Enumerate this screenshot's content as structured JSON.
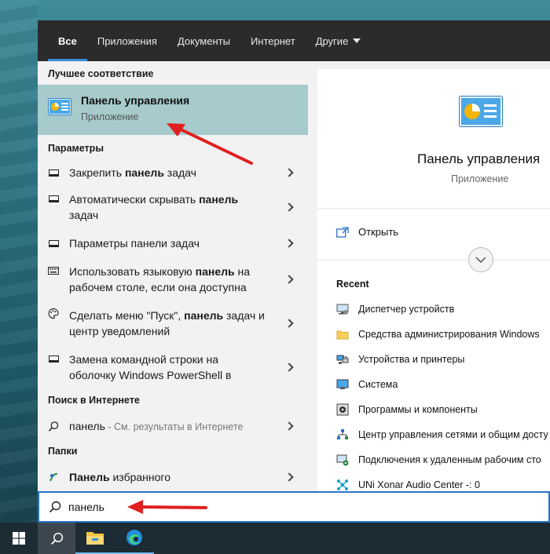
{
  "tabs": [
    {
      "label": "Все",
      "active": true
    },
    {
      "label": "Приложения"
    },
    {
      "label": "Документы"
    },
    {
      "label": "Интернет"
    },
    {
      "label": "Другие"
    }
  ],
  "best_match": {
    "heading": "Лучшее соответствие",
    "title": "Панель управления",
    "subtitle": "Приложение"
  },
  "settings": {
    "heading": "Параметры",
    "items": [
      {
        "pre": "Закрепить ",
        "bold": "панель",
        "post": " задач",
        "icon": "monitor-icon"
      },
      {
        "pre": "Автоматически скрывать ",
        "bold": "панель",
        "post": " задач",
        "icon": "monitor-icon"
      },
      {
        "pre": "Параметры панели задач",
        "bold": "",
        "post": "",
        "icon": "monitor-icon"
      },
      {
        "pre": "Использовать языковую ",
        "bold": "панель",
        "post": " на рабочем столе, если она доступна",
        "icon": "keyboard-icon"
      },
      {
        "pre": "Сделать меню \"Пуск\", ",
        "bold": "панель",
        "post": " задач и центр уведомлений",
        "icon": "palette-icon"
      },
      {
        "pre": "Замена командной строки на оболочку Windows PowerShell в",
        "bold": "",
        "post": "",
        "icon": "monitor-icon"
      }
    ]
  },
  "web": {
    "heading": "Поиск в Интернете",
    "query": "панель",
    "suffix": " - См. результаты в Интернете"
  },
  "folders": {
    "heading": "Папки",
    "item_bold": "Панель",
    "item_rest": " избранного"
  },
  "detail": {
    "title": "Панель управления",
    "subtitle": "Приложение",
    "open_label": "Открыть",
    "recent_heading": "Recent",
    "recent": [
      {
        "label": "Диспетчер устройств",
        "icon": "device-manager-icon"
      },
      {
        "label": "Средства администрирования Windows",
        "icon": "folder-icon"
      },
      {
        "label": "Устройства и принтеры",
        "icon": "printer-icon"
      },
      {
        "label": "Система",
        "icon": "system-icon"
      },
      {
        "label": "Программы и компоненты",
        "icon": "programs-icon"
      },
      {
        "label": "Центр управления сетями и общим досту",
        "icon": "network-icon"
      },
      {
        "label": "Подключения к удаленным рабочим сто",
        "icon": "remote-icon"
      },
      {
        "label": "UNi Xonar Audio Center -: 0",
        "icon": "audio-icon"
      }
    ]
  },
  "search": {
    "value": "панель"
  },
  "colors": {
    "accent": "#3b8fd6",
    "highlight": "#a7cacc",
    "arrow": "#e02020"
  }
}
